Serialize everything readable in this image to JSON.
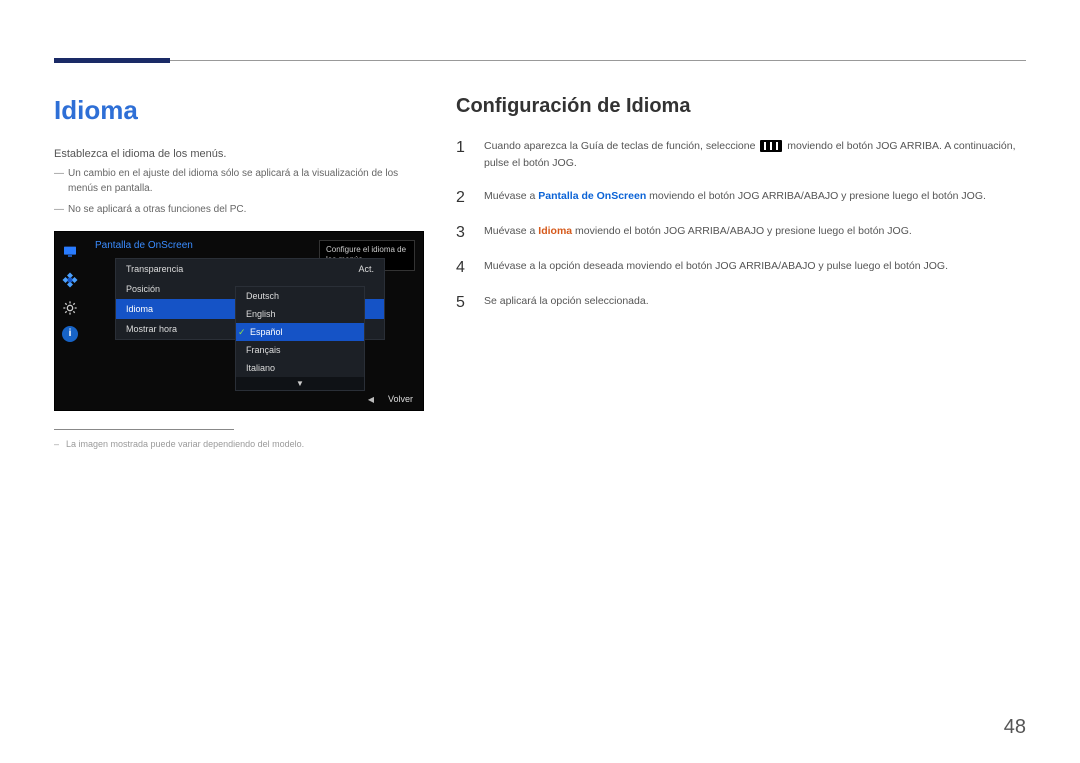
{
  "page_number": "48",
  "left": {
    "heading": "Idioma",
    "lead": "Establezca el idioma de los menús.",
    "note1": "Un cambio en el ajuste del idioma sólo se aplicará a la visualización de los menús en pantalla.",
    "note2": "No se aplicará a otras funciones del PC.",
    "footnote": "La imagen mostrada puede variar dependiendo del modelo."
  },
  "osd": {
    "title": "Pantalla de OnScreen",
    "tooltip": "Configure el idioma de los menús.",
    "menu": [
      {
        "label": "Transparencia",
        "value": "Act."
      },
      {
        "label": "Posición",
        "value": ""
      },
      {
        "label": "Idioma",
        "value": "",
        "selected": true
      },
      {
        "label": "Mostrar hora",
        "value": ""
      }
    ],
    "languages": [
      {
        "label": "Deutsch"
      },
      {
        "label": "English"
      },
      {
        "label": "Español",
        "selected": true
      },
      {
        "label": "Français"
      },
      {
        "label": "Italiano"
      }
    ],
    "footer_back": "Volver"
  },
  "right": {
    "heading": "Configuración de Idioma",
    "steps": {
      "s1_pre": "Cuando aparezca la Guía de teclas de función, seleccione ",
      "s1_post": " moviendo el botón JOG ARRIBA. A continuación, pulse el botón JOG.",
      "s2_pre": "Muévase a ",
      "s2_bold": "Pantalla de OnScreen",
      "s2_post": " moviendo el botón JOG ARRIBA/ABAJO y presione luego el botón JOG.",
      "s3_pre": "Muévase a ",
      "s3_bold": "Idioma",
      "s3_post": " moviendo el botón JOG ARRIBA/ABAJO y presione luego el botón JOG.",
      "s4": "Muévase a la opción deseada moviendo el botón JOG ARRIBA/ABAJO y pulse luego el botón JOG.",
      "s5": "Se aplicará la opción seleccionada."
    }
  }
}
